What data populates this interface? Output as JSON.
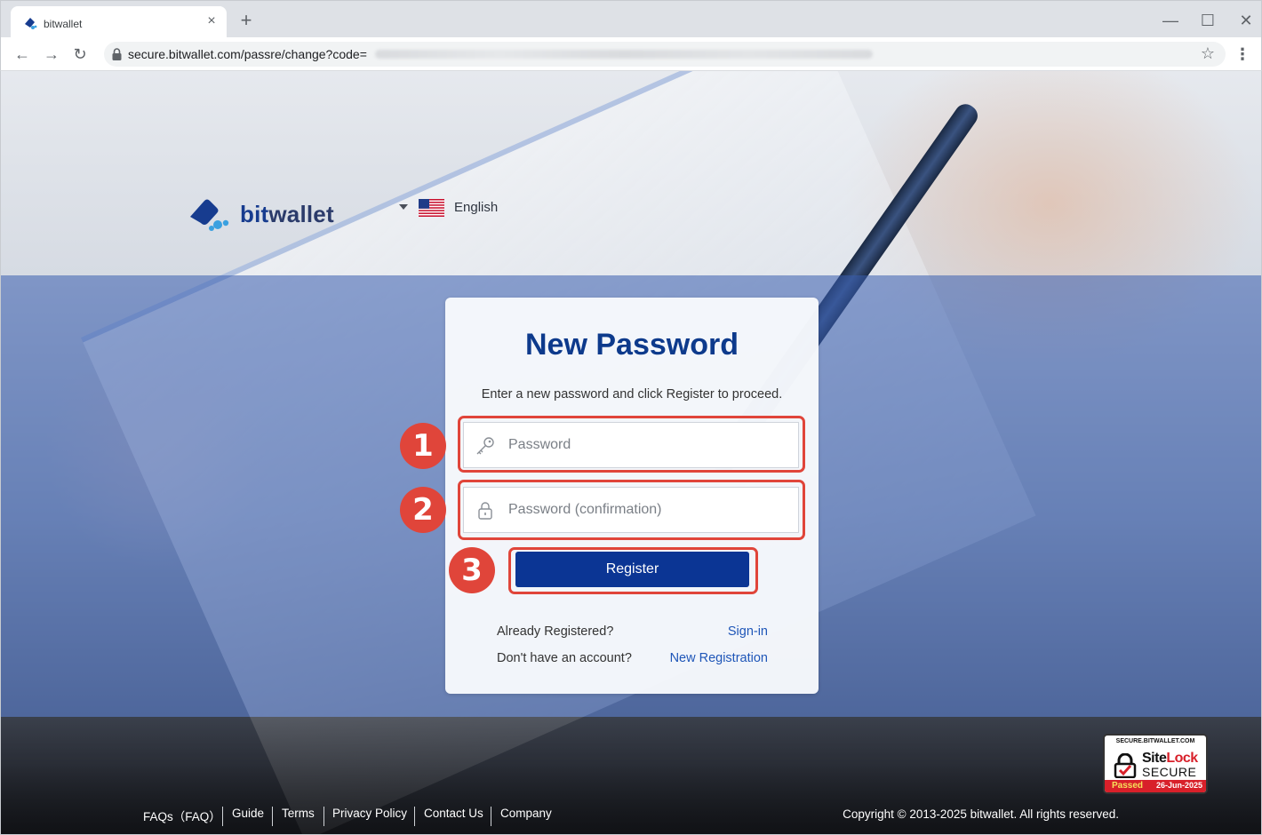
{
  "browser": {
    "tab_title": "bitwallet",
    "tab_close": "×",
    "new_tab": "+",
    "url": "secure.bitwallet.com/passre/change?code=",
    "nav_back": "←",
    "nav_forward": "→",
    "nav_reload": "↻",
    "win_minimize": "—",
    "win_maximize": "☐",
    "win_close": "✕",
    "star": "☆",
    "menu": "⋮"
  },
  "header": {
    "logo_bit": "bit",
    "logo_wallet": "wallet",
    "language": "English"
  },
  "card": {
    "title": "New Password",
    "description": "Enter a new password and click Register to proceed.",
    "password_placeholder": "Password",
    "confirm_placeholder": "Password (confirmation)",
    "register_label": "Register",
    "already_registered": "Already Registered?",
    "sign_in": "Sign-in",
    "no_account": "Don't have an account?",
    "new_registration": "New Registration"
  },
  "annotations": [
    "1",
    "2",
    "3"
  ],
  "sitelock": {
    "domain": "SECURE.BITWALLET.COM",
    "name_site": "Site",
    "name_lock": "Lock",
    "secure": "SECURE",
    "passed": "Passed",
    "date": "26-Jun-2025"
  },
  "footer": {
    "links": [
      "FAQs（FAQ）",
      "Guide",
      "Terms",
      "Privacy Policy",
      "Contact Us",
      "Company"
    ],
    "copyright": "Copyright © 2013-2025 bitwallet. All rights reserved."
  },
  "colors": {
    "brand_blue": "#0b3594",
    "title_blue": "#0d3a8c",
    "link_blue": "#1f56b8",
    "annotation_red": "#e0453a",
    "band_overlay": "#385caf"
  },
  "icons": [
    "bitwallet-favicon-icon",
    "lock-icon",
    "star-icon",
    "key-icon",
    "padlock-icon",
    "us-flag-icon",
    "caret-down-icon"
  ]
}
